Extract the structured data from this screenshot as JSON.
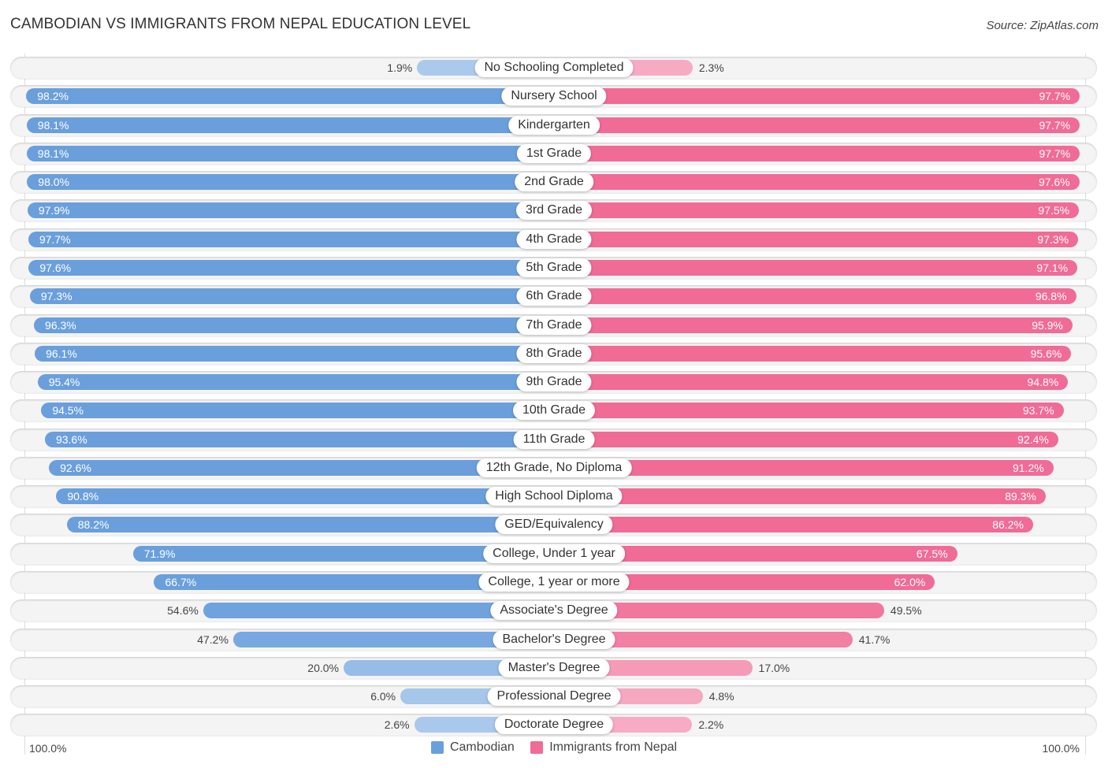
{
  "header": {
    "title": "CAMBODIAN VS IMMIGRANTS FROM NEPAL EDUCATION LEVEL",
    "source": "Source: ZipAtlas.com"
  },
  "axis": {
    "left_label": "100.0%",
    "right_label": "100.0%"
  },
  "legend": [
    {
      "name": "Cambodian",
      "color": "#6a9fdc"
    },
    {
      "name": "Immigrants from Nepal",
      "color": "#f06b96"
    }
  ],
  "chart_data": {
    "type": "bar",
    "orientation": "horizontal-diverging",
    "title": "CAMBODIAN VS IMMIGRANTS FROM NEPAL EDUCATION LEVEL",
    "xlabel": "",
    "ylabel": "",
    "xlim": [
      0,
      100
    ],
    "legend_position": "bottom",
    "categories": [
      "No Schooling Completed",
      "Nursery School",
      "Kindergarten",
      "1st Grade",
      "2nd Grade",
      "3rd Grade",
      "4th Grade",
      "5th Grade",
      "6th Grade",
      "7th Grade",
      "8th Grade",
      "9th Grade",
      "10th Grade",
      "11th Grade",
      "12th Grade, No Diploma",
      "High School Diploma",
      "GED/Equivalency",
      "College, Under 1 year",
      "College, 1 year or more",
      "Associate's Degree",
      "Bachelor's Degree",
      "Master's Degree",
      "Professional Degree",
      "Doctorate Degree"
    ],
    "series": [
      {
        "name": "Cambodian",
        "color": "#6a9fdc",
        "values": [
          1.9,
          98.2,
          98.1,
          98.1,
          98.0,
          97.9,
          97.7,
          97.6,
          97.3,
          96.3,
          96.1,
          95.4,
          94.5,
          93.6,
          92.6,
          90.8,
          88.2,
          71.9,
          66.7,
          54.6,
          47.2,
          20.0,
          6.0,
          2.6
        ]
      },
      {
        "name": "Immigrants from Nepal",
        "color": "#f06b96",
        "values": [
          2.3,
          97.7,
          97.7,
          97.7,
          97.6,
          97.5,
          97.3,
          97.1,
          96.8,
          95.9,
          95.6,
          94.8,
          93.7,
          92.4,
          91.2,
          89.3,
          86.2,
          67.5,
          62.0,
          49.5,
          41.7,
          17.0,
          4.8,
          2.2
        ]
      }
    ]
  }
}
